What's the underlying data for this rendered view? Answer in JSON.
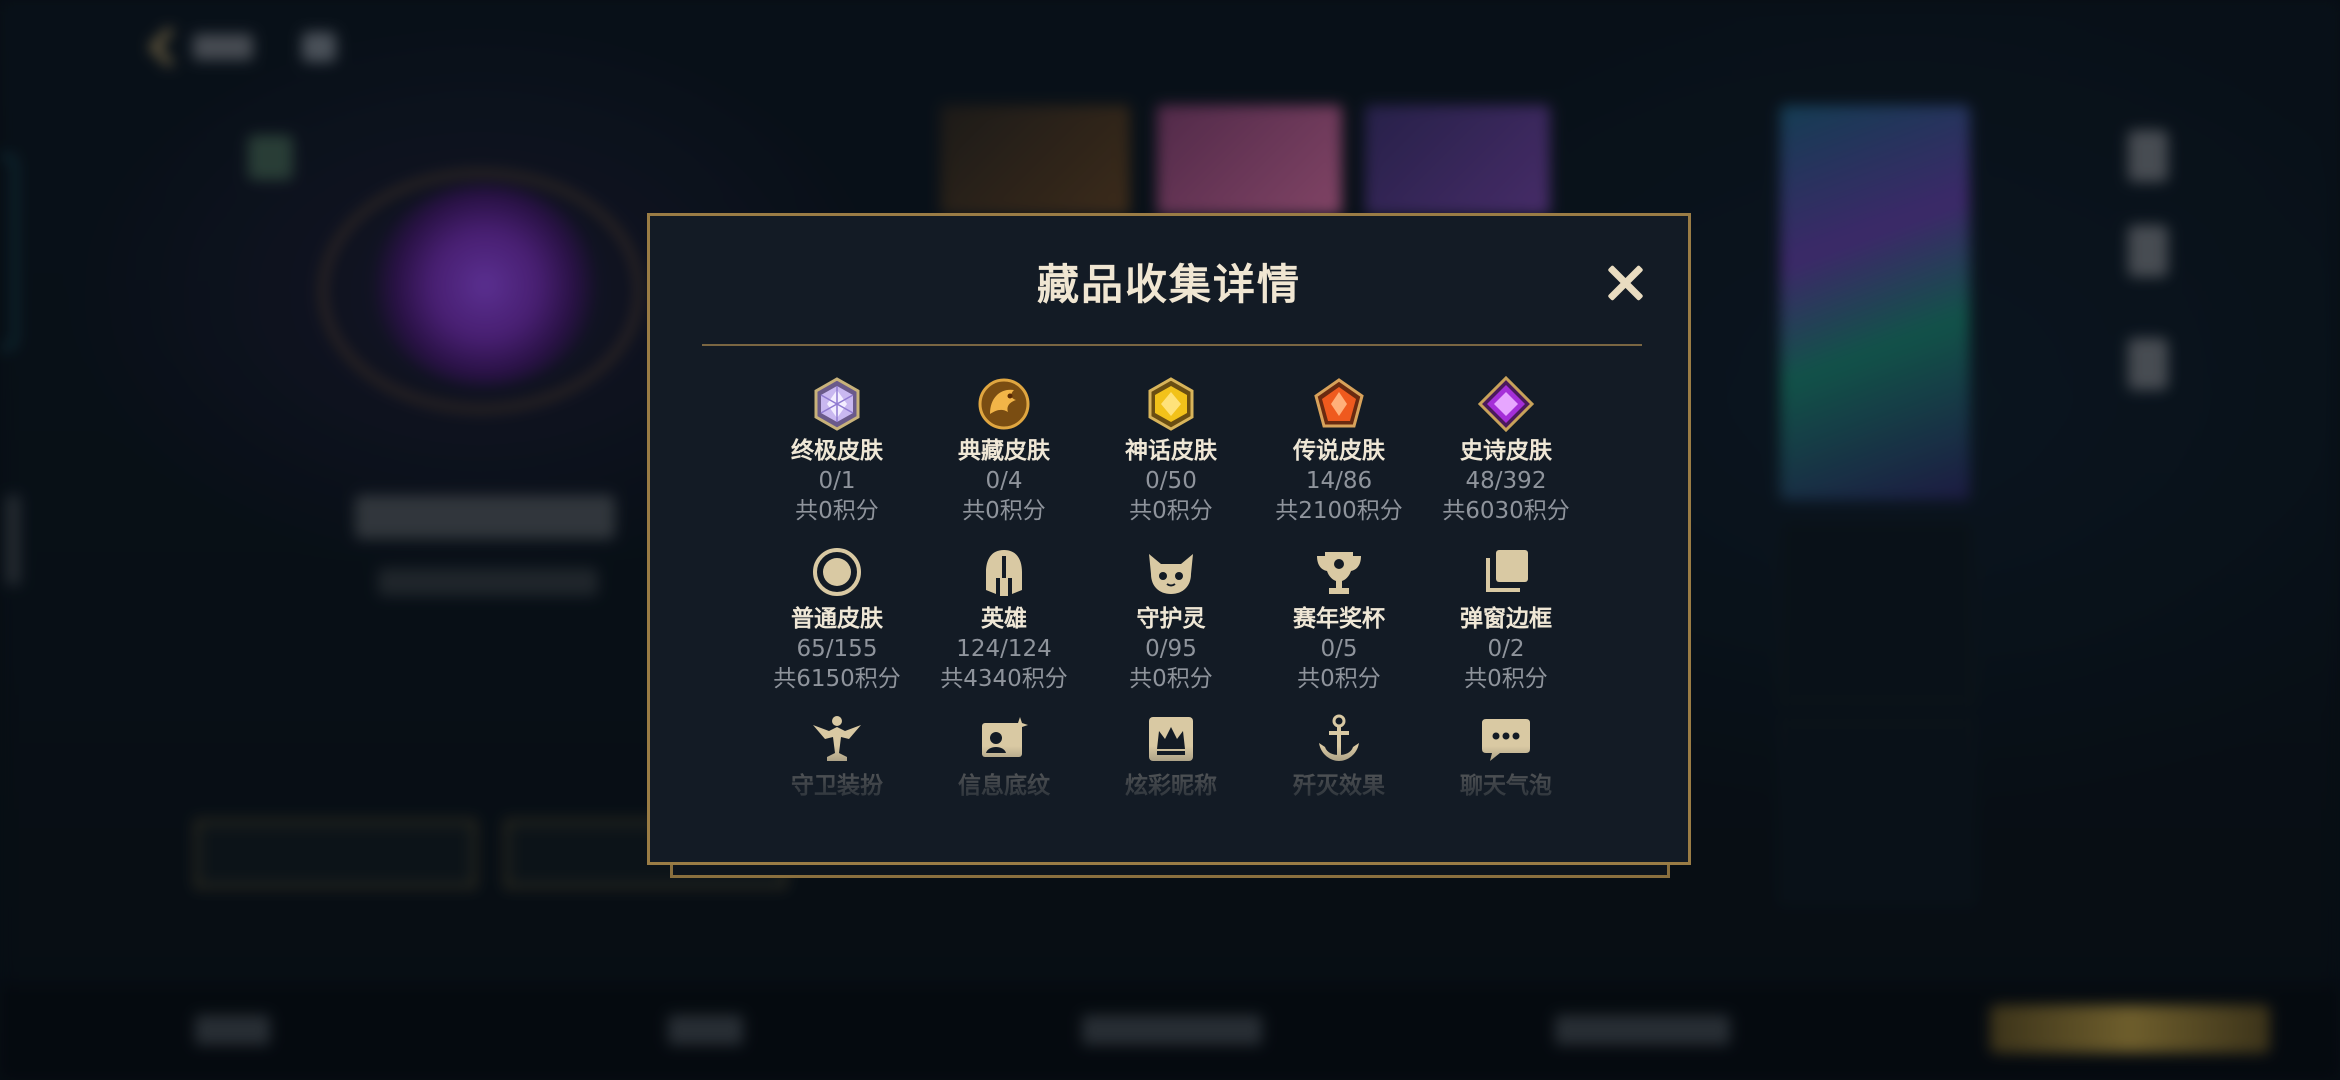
{
  "background": {
    "accent_color": "#c8aa6e"
  },
  "modal": {
    "title": "藏品收集详情",
    "close_icon": "close-icon",
    "items": [
      {
        "name": "终极皮肤",
        "count": "0/1",
        "points": "共0积分",
        "icon": "ultimate-skin-gem-icon"
      },
      {
        "name": "典藏皮肤",
        "count": "0/4",
        "points": "共0积分",
        "icon": "collection-skin-dragon-icon"
      },
      {
        "name": "神话皮肤",
        "count": "0/50",
        "points": "共0积分",
        "icon": "mythic-skin-gem-icon"
      },
      {
        "name": "传说皮肤",
        "count": "14/86",
        "points": "共2100积分",
        "icon": "legendary-skin-gem-icon"
      },
      {
        "name": "史诗皮肤",
        "count": "48/392",
        "points": "共6030积分",
        "icon": "epic-skin-gem-icon"
      },
      {
        "name": "普通皮肤",
        "count": "65/155",
        "points": "共6150积分",
        "icon": "common-skin-circle-icon"
      },
      {
        "name": "英雄",
        "count": "124/124",
        "points": "共4340积分",
        "icon": "champion-helmet-icon"
      },
      {
        "name": "守护灵",
        "count": "0/95",
        "points": "共0积分",
        "icon": "guardian-creature-icon"
      },
      {
        "name": "赛年奖杯",
        "count": "0/5",
        "points": "共0积分",
        "icon": "trophy-icon"
      },
      {
        "name": "弹窗边框",
        "count": "0/2",
        "points": "共0积分",
        "icon": "popup-frame-icon"
      },
      {
        "name": "守卫装扮",
        "icon": "ward-skin-icon"
      },
      {
        "name": "信息底纹",
        "icon": "info-card-icon"
      },
      {
        "name": "炫彩昵称",
        "icon": "crown-nameplate-icon"
      },
      {
        "name": "歼灭效果",
        "icon": "anchor-icon"
      },
      {
        "name": "聊天气泡",
        "icon": "chat-bubble-icon"
      }
    ]
  }
}
